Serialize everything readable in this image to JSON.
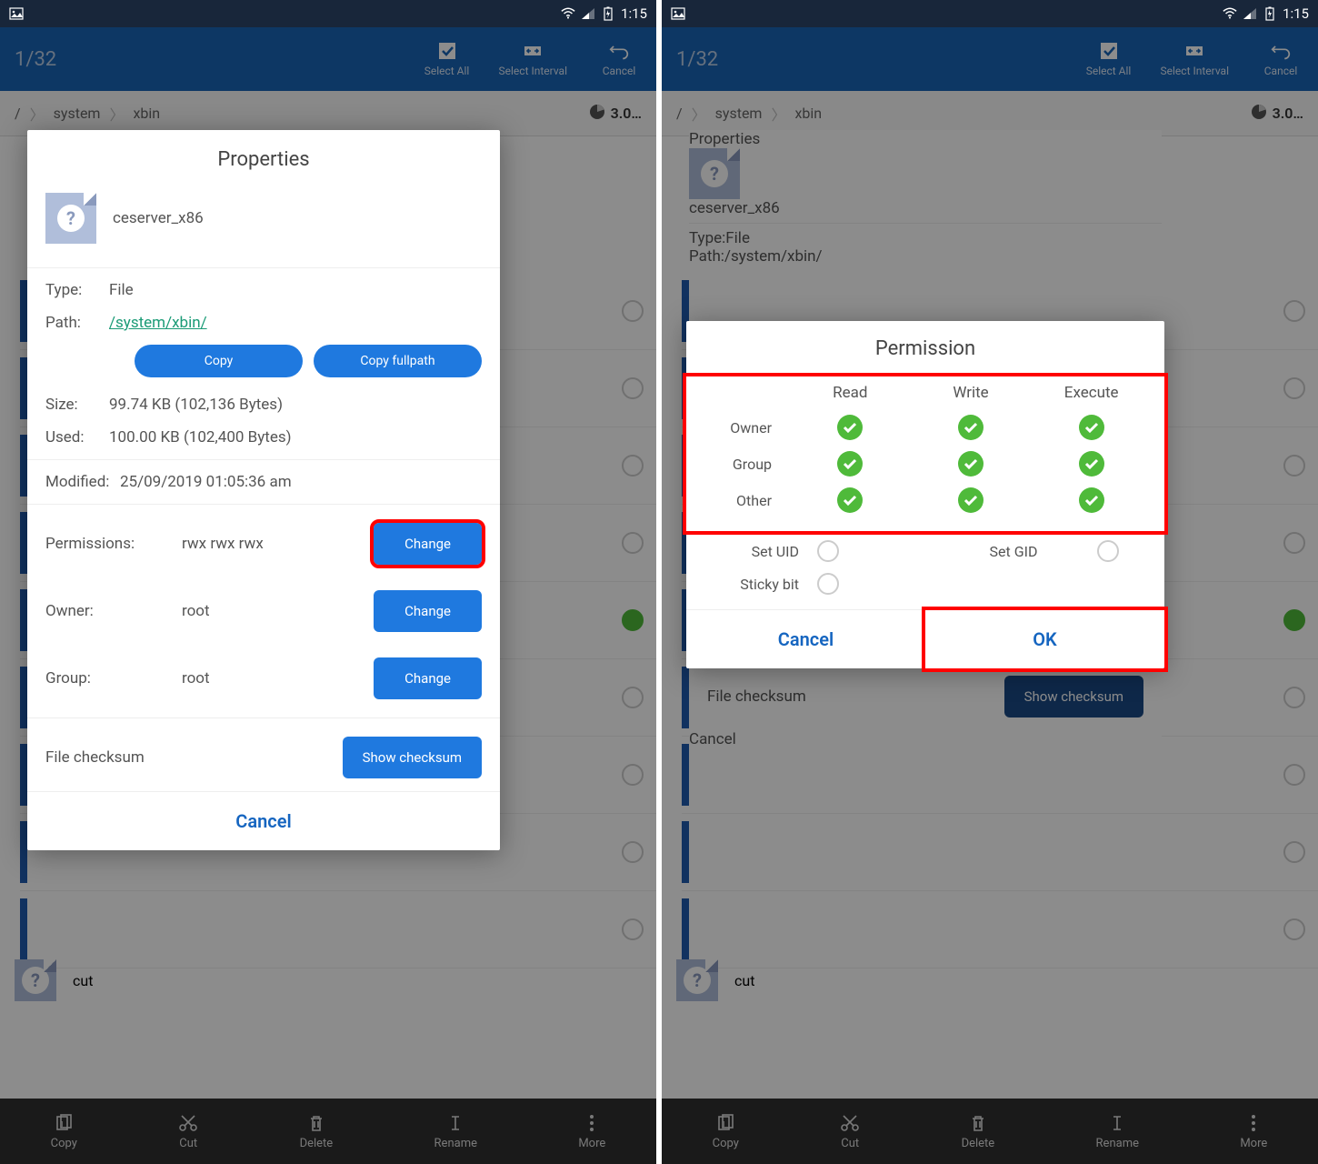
{
  "status": {
    "time": "1:15"
  },
  "appbar": {
    "counter": "1/32",
    "select_all": "Select All",
    "select_interval": "Select Interval",
    "cancel": "Cancel"
  },
  "breadcrumb": {
    "root": "/",
    "seg1": "system",
    "seg2": "xbin",
    "storage": "3.0…"
  },
  "bottombar": {
    "copy": "Copy",
    "cut": "Cut",
    "delete": "Delete",
    "rename": "Rename",
    "more": "More"
  },
  "bg": {
    "cut": "cut"
  },
  "properties": {
    "title": "Properties",
    "filename": "ceserver_x86",
    "type_k": "Type:",
    "type_v": "File",
    "path_k": "Path:",
    "path_v": "/system/xbin/",
    "copy_btn": "Copy",
    "copy_full_btn": "Copy fullpath",
    "size_k": "Size:",
    "size_v": "99.74 KB (102,136 Bytes)",
    "used_k": "Used:",
    "used_v": "100.00 KB (102,400 Bytes)",
    "modified_k": "Modified:",
    "modified_v": "25/09/2019 01:05:36 am",
    "perm_k": "Permissions:",
    "perm_v": "rwx rwx rwx",
    "owner_k": "Owner:",
    "owner_v": "root",
    "group_k": "Group:",
    "group_v": "root",
    "change": "Change",
    "checksum_k": "File checksum",
    "show_checksum": "Show checksum",
    "cancel": "Cancel"
  },
  "permission": {
    "title": "Permission",
    "read": "Read",
    "write": "Write",
    "execute": "Execute",
    "owner": "Owner",
    "group": "Group",
    "other": "Other",
    "set_uid": "Set UID",
    "set_gid": "Set GID",
    "sticky": "Sticky bit",
    "cancel": "Cancel",
    "ok": "OK",
    "rights": {
      "owner": {
        "read": true,
        "write": true,
        "execute": true
      },
      "group": {
        "read": true,
        "write": true,
        "execute": true
      },
      "other": {
        "read": true,
        "write": true,
        "execute": true
      },
      "set_uid": false,
      "set_gid": false,
      "sticky": false
    }
  }
}
